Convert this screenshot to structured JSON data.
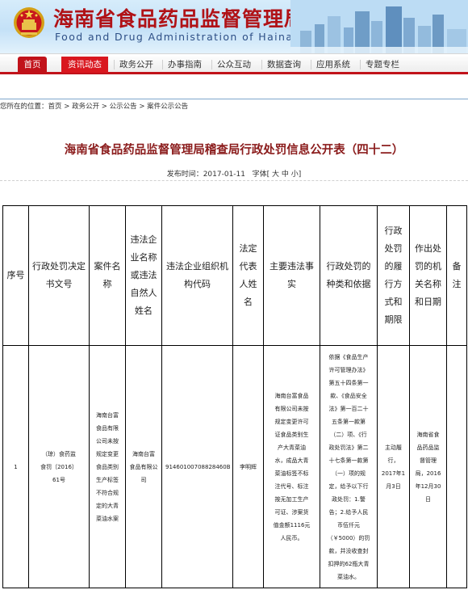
{
  "header": {
    "title": "海南省食品药品监督管理局",
    "subtitle": "Food and Drug Administration of Hainan"
  },
  "nav": {
    "items": [
      {
        "label": "首页"
      },
      {
        "label": "资讯动态"
      },
      {
        "label": "政务公开"
      },
      {
        "label": "办事指南"
      },
      {
        "label": "公众互动"
      },
      {
        "label": "数据查询"
      },
      {
        "label": "应用系统"
      },
      {
        "label": "专题专栏"
      }
    ]
  },
  "breadcrumb": {
    "prefix": "您所在的位置：",
    "items": [
      "首页",
      "政务公开",
      "公示公告",
      "案件公示公告"
    ],
    "separator": " > "
  },
  "article": {
    "title": "海南省食品药品监督管理局稽查局行政处罚信息公开表（四十二）",
    "published_label": "发布时间：",
    "published_date": "2017-01-11",
    "font_label": "字体[",
    "font_large": "大",
    "font_medium": "中",
    "font_small": "小",
    "font_close": "]"
  },
  "table": {
    "headers": [
      "序号",
      "行政处罚决定书文号",
      "案件名称",
      "违法企业名称或违法自然人姓名",
      "违法企业组织机构代码",
      "法定代表人姓名",
      "主要违法事实",
      "行政处罚的种类和依据",
      "行政处罚的履行方式和期限",
      "作出处罚的机关名称和日期",
      "备注"
    ],
    "rows": [
      {
        "no": "1",
        "decision_no": "（琼）食药监\n食罚〔2016〕\n61号",
        "case_name": "海南台富\n食品有限\n公司未按\n规定变更\n食品类别\n生产标签\n不符合规\n定的大青\n菜油水案",
        "company": "海南台富\n食品有限公\n司",
        "org_code": "91460100708828460B",
        "legal_rep": "李明辉",
        "facts": "海南台富食品\n有限公司未按\n规定变更许可\n证食品类别生\n产大青菜油\n水，成品大青\n菜油标签不标\n注代号、标注\n按无加工生产\n可证、涉案货\n值金额1116元\n人民币。",
        "penalty_basis": "依据《食品生产\n许可管理办法》\n第五十四条第一\n款、《食品安全\n法》第一百二十\n五条第一款第\n（二）项、《行\n政处罚法》第二\n十七条第一款第\n（一）项的规\n定，给予以下行\n政处罚：1.警\n告；2.给予人民\n币伍仟元\n（￥5000）的罚\n款，并没收查封\n扣押的62瓶大青\n菜油水。",
        "execution": "主动履\n行，\n2017年1\n月3日",
        "authority": "海南省食\n品药品监\n督管理\n局，2016\n年12月30\n日",
        "remarks": ""
      }
    ]
  }
}
